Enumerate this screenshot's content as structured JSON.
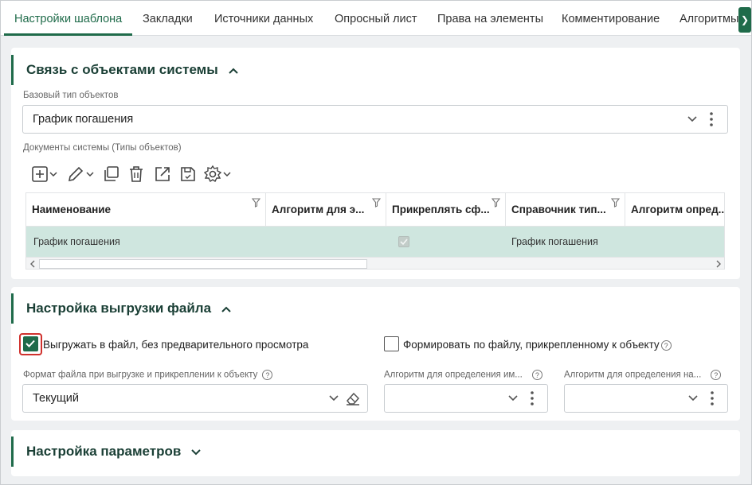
{
  "tabs": [
    {
      "label": "Настройки шаблона",
      "active": true
    },
    {
      "label": "Закладки"
    },
    {
      "label": "Источники данных"
    },
    {
      "label": "Опросный лист"
    },
    {
      "label": "Права на элементы"
    },
    {
      "label": "Комментирование"
    },
    {
      "label": "Алгоритмы"
    }
  ],
  "tabs_next_icon": "chevron-right-icon",
  "section1": {
    "title": "Связь с объектами системы",
    "base_type_label": "Базовый тип объектов",
    "base_type_value": "График погашения",
    "docs_label": "Документы системы (Типы объектов)",
    "toolbar_icons": [
      "add-icon",
      "edit-icon",
      "copy-icon",
      "delete-icon",
      "open-external-icon",
      "save-icon",
      "settings-icon"
    ],
    "grid": {
      "columns": [
        "Наименование",
        "Алгоритм для э...",
        "Прикреплять сф...",
        "Справочник тип...",
        "Алгоритм опред..."
      ],
      "rows": [
        {
          "name": "График погашения",
          "algorithm": "",
          "attach": true,
          "reference": "График погашения",
          "algorithm2": ""
        }
      ]
    }
  },
  "section2": {
    "title": "Настройка выгрузки файла",
    "checkbox1": {
      "label": "Выгружать в файл, без предварительного просмотра",
      "checked": true
    },
    "checkbox2": {
      "label": "Формировать по файлу, прикрепленному к объекту",
      "checked": false
    },
    "format_label": "Формат файла при выгрузке и прикреплении к объекту",
    "format_value": "Текущий",
    "alg_name_label": "Алгоритм для определения им...",
    "alg_name2_label": "Алгоритм для определения на..."
  },
  "section3": {
    "title": "Настройка параметров"
  },
  "colors": {
    "accent": "#1f6b4a",
    "row_selected": "#cfe6df",
    "focus": "#d0312d"
  }
}
